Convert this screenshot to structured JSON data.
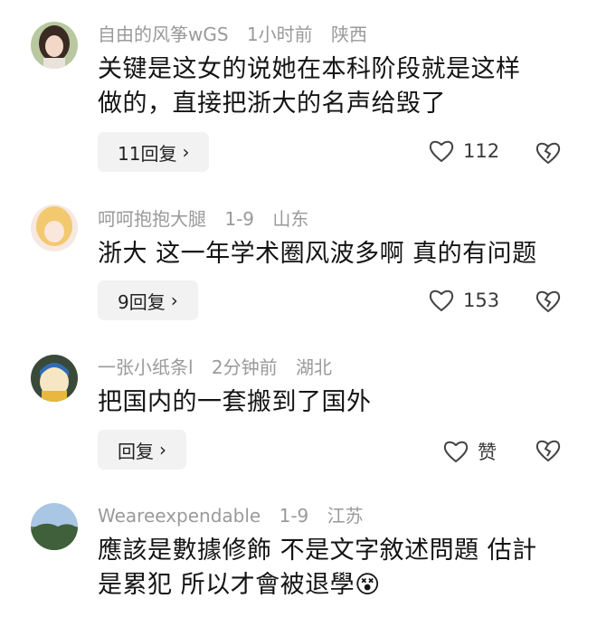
{
  "comments": [
    {
      "username": "自由的风筝wGS",
      "time": "1小时前",
      "location": "陕西",
      "text_line1": "关键是这女的说她在本科阶段就是这样",
      "text_line2": "做的，直接把浙大的名声给毁了",
      "reply_label": "11回复",
      "likes": "112"
    },
    {
      "username": "呵呵抱抱大腿",
      "time": "1-9",
      "location": "山东",
      "text_line1": "浙大 这一年学术圈风波多啊 真的有问题",
      "reply_label": "9回复",
      "likes": "153"
    },
    {
      "username": "一张小纸条l",
      "time": "2分钟前",
      "location": "湖北",
      "text_line1": "把国内的一套搬到了国外",
      "reply_label": "回复",
      "likes": "赞"
    },
    {
      "username": "Weareexpendable",
      "time": "1-9",
      "location": "江苏",
      "text_line1": "應該是數據修飾 不是文字敘述問題 估計",
      "text_line2": "是累犯 所以才會被退學",
      "emoji": "😵"
    }
  ],
  "icons": {
    "heart": "heart-outline-icon",
    "dislike": "broken-heart-icon",
    "chevron": "chevron-right-icon"
  },
  "colors": {
    "meta": "#9a9a9a",
    "text": "#141414",
    "button_bg": "#f2f2f2"
  }
}
